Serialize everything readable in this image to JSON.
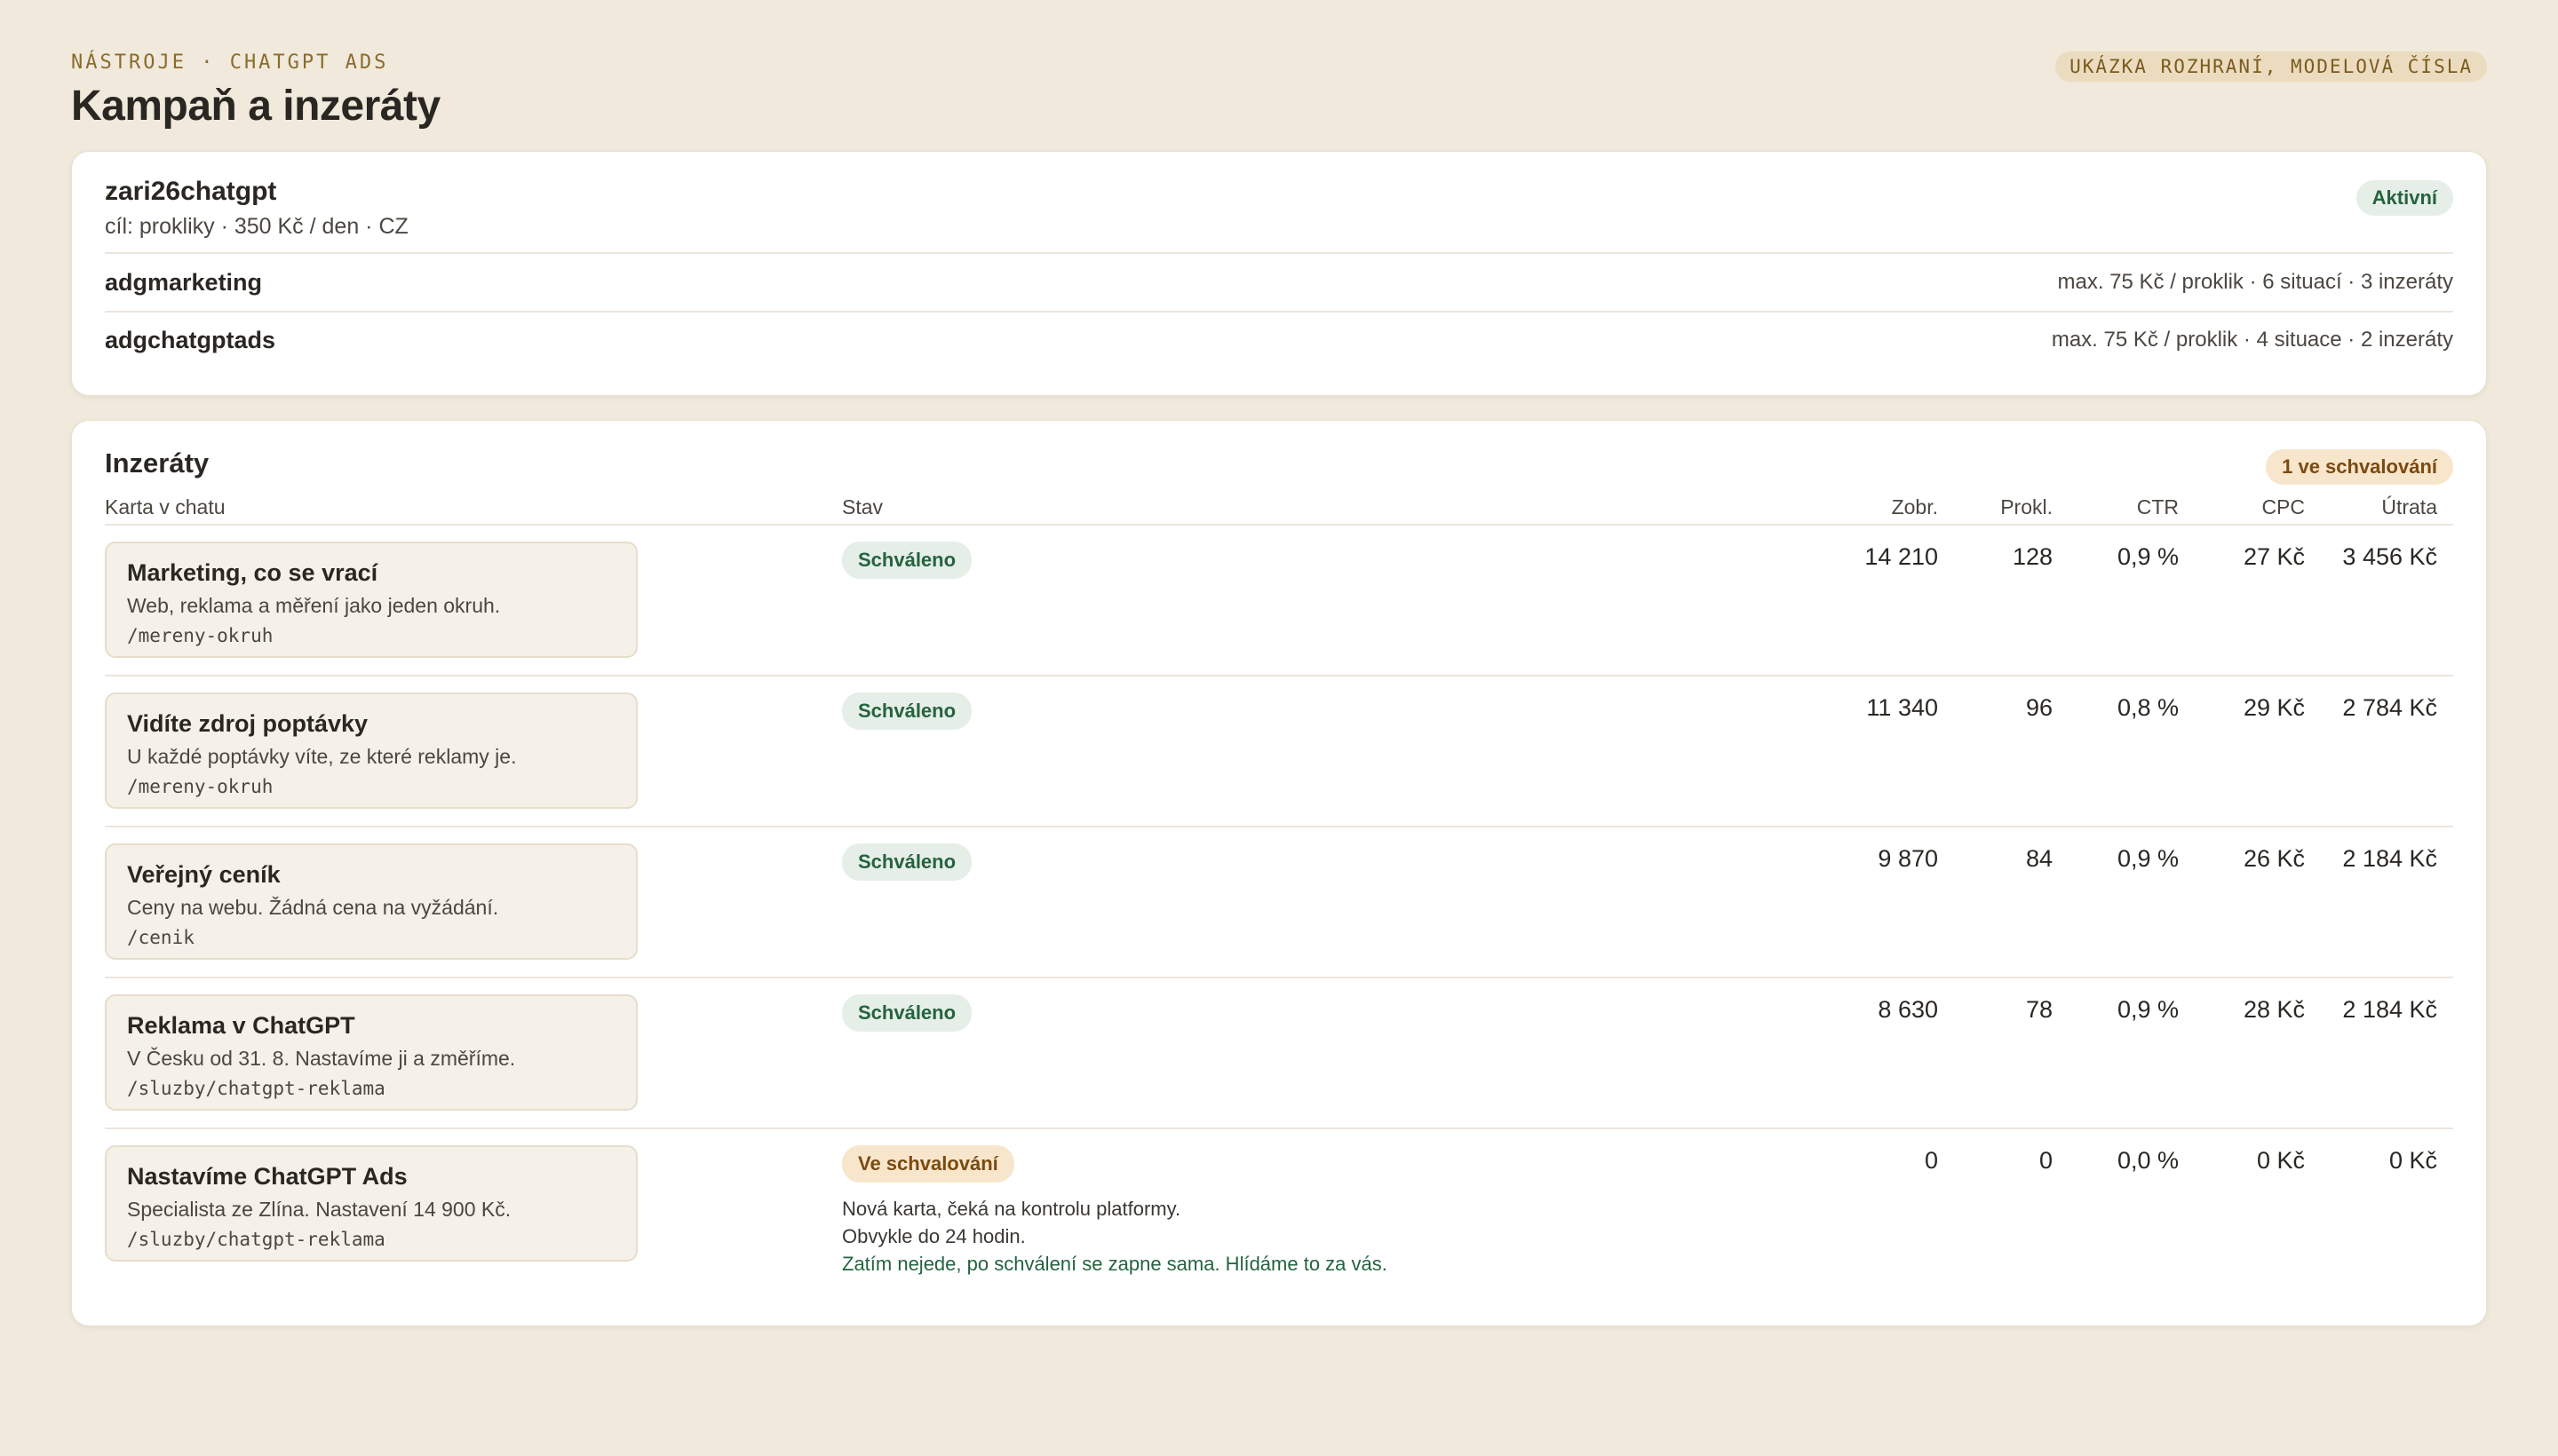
{
  "header": {
    "eyebrow": "NÁSTROJE · CHATGPT ADS",
    "title": "Kampaň a inzeráty",
    "demo_pill": "UKÁZKA ROZHRANÍ, MODELOVÁ ČÍSLA"
  },
  "campaign": {
    "name": "zari26chatgpt",
    "meta": "cíl: prokliky · 350 Kč / den · CZ",
    "status": "Aktivní",
    "adgroups": [
      {
        "name": "adgmarketing",
        "meta": "max. 75 Kč / proklik · 6 situací · 3 inzeráty"
      },
      {
        "name": "adgchatgptads",
        "meta": "max. 75 Kč / proklik · 4 situace · 2 inzeráty"
      }
    ]
  },
  "ads": {
    "title": "Inzeráty",
    "pending_badge": "1 ve schvalování",
    "columns": {
      "card": "Karta v chatu",
      "status": "Stav",
      "impressions": "Zobr.",
      "clicks": "Prokl.",
      "ctr": "CTR",
      "cpc": "CPC",
      "spend": "Útrata"
    },
    "rows": [
      {
        "title": "Marketing, co se vrací",
        "desc": "Web, reklama a měření jako jeden okruh.",
        "url": "/mereny-okruh",
        "status": "Schváleno",
        "impressions": "14 210",
        "clicks": "128",
        "ctr": "0,9 %",
        "cpc": "27 Kč",
        "spend": "3 456 Kč"
      },
      {
        "title": "Vidíte zdroj poptávky",
        "desc": "U každé poptávky víte, ze které reklamy je.",
        "url": "/mereny-okruh",
        "status": "Schváleno",
        "impressions": "11 340",
        "clicks": "96",
        "ctr": "0,8 %",
        "cpc": "29 Kč",
        "spend": "2 784 Kč"
      },
      {
        "title": "Veřejný ceník",
        "desc": "Ceny na webu. Žádná cena na vyžádání.",
        "url": "/cenik",
        "status": "Schváleno",
        "impressions": "9 870",
        "clicks": "84",
        "ctr": "0,9 %",
        "cpc": "26 Kč",
        "spend": "2 184 Kč"
      },
      {
        "title": "Reklama v ChatGPT",
        "desc": "V Česku od 31. 8. Nastavíme ji a změříme.",
        "url": "/sluzby/chatgpt-reklama",
        "status": "Schváleno",
        "impressions": "8 630",
        "clicks": "78",
        "ctr": "0,9 %",
        "cpc": "28 Kč",
        "spend": "2 184 Kč"
      },
      {
        "title": "Nastavíme ChatGPT Ads",
        "desc": "Specialista ze Zlína. Nastavení 14 900 Kč.",
        "url": "/sluzby/chatgpt-reklama",
        "status": "Ve schvalování",
        "note_line1": "Nová karta, čeká na kontrolu platformy.",
        "note_line2": "Obvykle do 24 hodin.",
        "note_line3": "Zatím nejede, po schválení se zapne sama. Hlídáme to za vás.",
        "impressions": "0",
        "clicks": "0",
        "ctr": "0,0 %",
        "cpc": "0 Kč",
        "spend": "0 Kč"
      }
    ]
  },
  "colors": {
    "background": "#f0e9dc",
    "accent_gold": "#8a6c2a",
    "status_green": "#25633f",
    "status_amber": "#7a4a10"
  }
}
